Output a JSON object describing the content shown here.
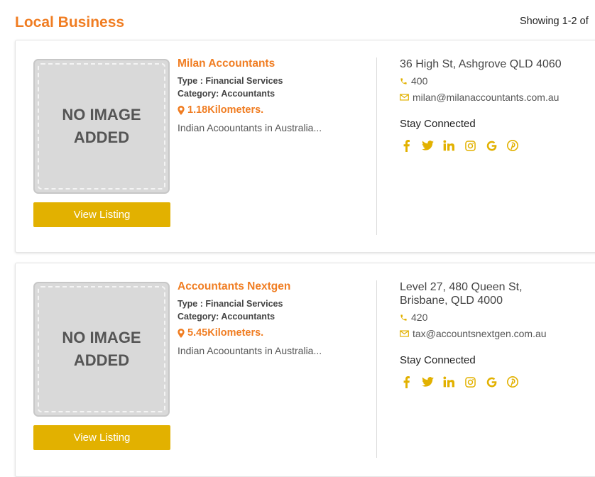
{
  "header": {
    "title": "Local Business",
    "showing": "Showing 1-2 of"
  },
  "listings": [
    {
      "image_text": "NO IMAGE ADDED",
      "button_label": "View Listing",
      "name": "Milan Accountants",
      "type": "Type : Financial Services",
      "category": "Category: Accountants",
      "distance": "1.18Kilometers.",
      "description": "Indian Acoountants in Australia...",
      "address": "36 High St, Ashgrove QLD 4060",
      "phone": "400",
      "email": "milan@milanaccountants.com.au",
      "stay_connected": "Stay Connected"
    },
    {
      "image_text": "NO IMAGE ADDED",
      "button_label": "View Listing",
      "name": "Accountants Nextgen",
      "type": "Type : Financial Services",
      "category": "Category: Accountants",
      "distance": "5.45Kilometers.",
      "description": "Indian Acoountants in Australia...",
      "address": "Level 27, 480 Queen St, Brisbane, QLD 4000",
      "phone": "420",
      "email": "tax@accountsnextgen.com.au",
      "stay_connected": "Stay Connected"
    }
  ],
  "social_icons": [
    "facebook-icon",
    "twitter-icon",
    "linkedin-icon",
    "instagram-icon",
    "google-icon",
    "pinterest-icon"
  ],
  "colors": {
    "accent_orange": "#f07d22",
    "accent_gold": "#e2b100",
    "placeholder_gray": "#d9d9d9"
  }
}
